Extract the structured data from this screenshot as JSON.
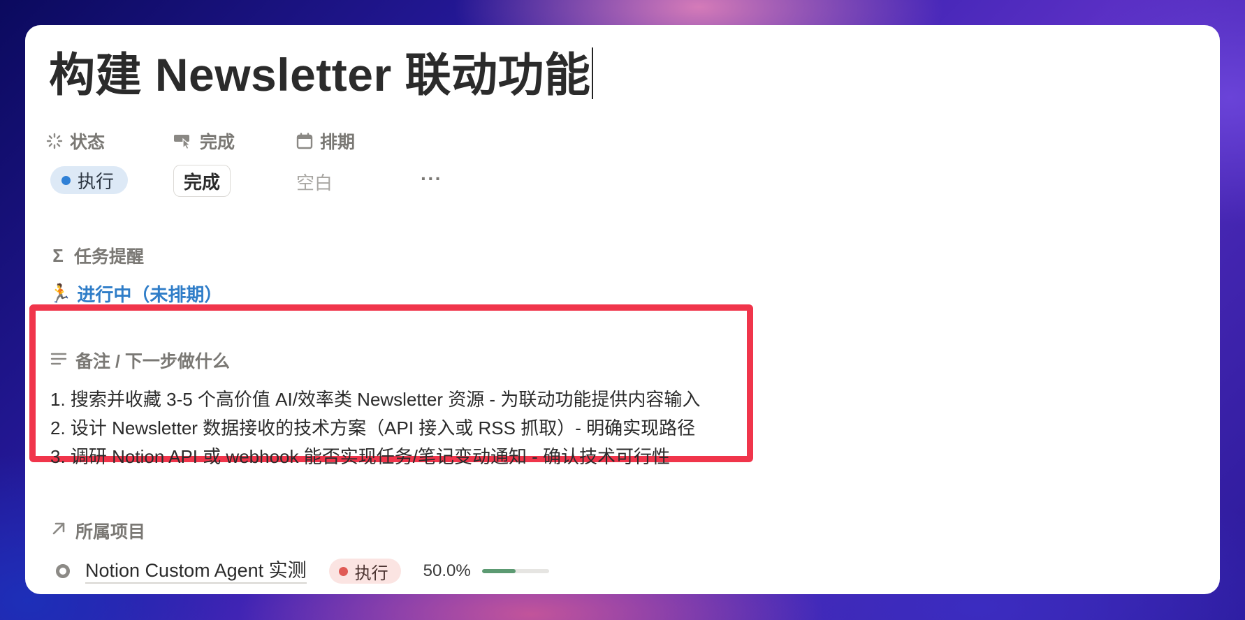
{
  "page": {
    "title": "构建 Newsletter 联动功能"
  },
  "properties": {
    "status": {
      "label": "状态",
      "value": "执行"
    },
    "done": {
      "label": "完成",
      "button_label": "完成"
    },
    "schedule": {
      "label": "排期",
      "value": "空白"
    },
    "more_label": "···"
  },
  "reminder": {
    "label": "任务提醒",
    "emoji": "🏃",
    "value": "进行中（未排期）"
  },
  "notes": {
    "label": "备注 / 下一步做什么",
    "lines": [
      "1. 搜索并收藏 3-5 个高价值 AI/效率类 Newsletter 资源 - 为联动功能提供内容输入",
      "2. 设计 Newsletter 数据接收的技术方案（API 接入或 RSS 抓取）- 明确实现路径",
      "3. 调研 Notion API 或 webhook 能否实现任务/笔记变动通知 - 确认技术可行性"
    ]
  },
  "project": {
    "label": "所属项目",
    "name": "Notion Custom Agent 实测",
    "status": "执行",
    "progress_text": "50.0%",
    "progress_fraction": 0.5
  },
  "colors": {
    "status_blue": "#2f80d6",
    "highlight_red": "#f0354b",
    "project_status_red": "#e05a55",
    "progress_green": "#5c9a72",
    "link_blue": "#2f7dc8"
  },
  "icons": {
    "status": "loader-icon",
    "done": "pointer-icon",
    "schedule": "calendar-icon",
    "reminder": "sigma-icon",
    "notes": "text-lines-icon",
    "project": "arrow-up-right-icon"
  }
}
